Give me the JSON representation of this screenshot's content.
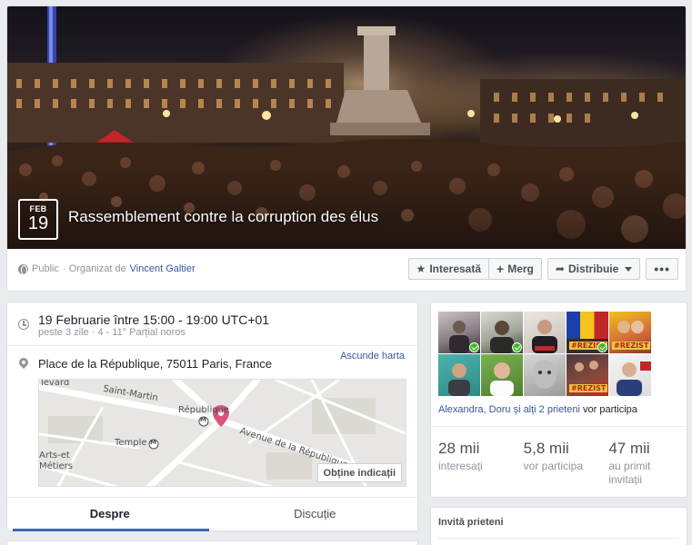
{
  "event": {
    "month": "FEB",
    "day": "19",
    "title": "Rassemblement contre la corruption des élus",
    "privacy": "Public",
    "organized_by": "· Organizat de",
    "organizer": "Vincent Galtier"
  },
  "actions": {
    "interested": "Interesată",
    "going": "Merg",
    "share": "Distribuie",
    "more": "•••"
  },
  "details": {
    "datetime": "19 Februarie între 15:00 - 19:00 UTC+01",
    "datetime_sub": "peste 3 zile · 4 - 11° Parțial noros",
    "place": "Place de la République, 75011 Paris, France",
    "hide_map": "Ascunde harta",
    "directions": "Obține indicații",
    "map_labels": {
      "street1": "levard",
      "street2": "Saint-Martin",
      "metro1": "République",
      "metro2": "Temple",
      "metro_symbol": "M",
      "avenue": "Avenue de la République",
      "district1": "Arts-et",
      "district2": "Métiers"
    }
  },
  "tabs": [
    {
      "label": "Despre",
      "active": true
    },
    {
      "label": "Discuție",
      "active": false
    }
  ],
  "guests": {
    "avatar_tags": [
      "#REZIST",
      "#REZIST",
      "#REZIST"
    ],
    "going_names": "Alexandra, Doru",
    "going_rest": "și alți 2 prieteni",
    "going_suffix": "vor participa",
    "stats": [
      {
        "num": "28 mii",
        "label": "interesați"
      },
      {
        "num": "5,8 mii",
        "label": "vor participa"
      },
      {
        "num": "47 mii",
        "label": "au primit invitații"
      }
    ]
  },
  "invite": {
    "header": "Invită prieteni"
  },
  "colors": {
    "accent": "#4267b2",
    "link": "#365899",
    "check": "#42b72a",
    "pin": "#d9537a"
  }
}
